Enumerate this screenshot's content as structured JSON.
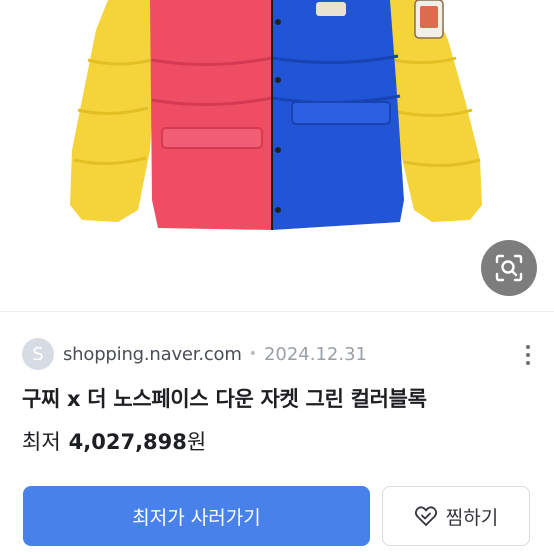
{
  "product_image": {
    "icon": "jacket-image",
    "colors": {
      "yellow": "#f4d43a",
      "red": "#ee4d64",
      "blue": "#2255d6"
    }
  },
  "lens_button": {
    "icon": "image-search-icon"
  },
  "source": {
    "favicon_letter": "S",
    "domain": "shopping.naver.com",
    "separator": "•",
    "date": "2024.12.31"
  },
  "more_menu": {
    "icon": "more-vertical-icon"
  },
  "product": {
    "title": "구찌 x 더 노스페이스 다운 자켓 그린 컬러블록",
    "price_label": "최저",
    "price_value": "4,027,898",
    "price_unit": "원"
  },
  "actions": {
    "buy_label": "최저가 사러가기",
    "wish_label": "찜하기",
    "wish_icon": "heart-check-icon"
  },
  "accent_color": "#4881ea"
}
